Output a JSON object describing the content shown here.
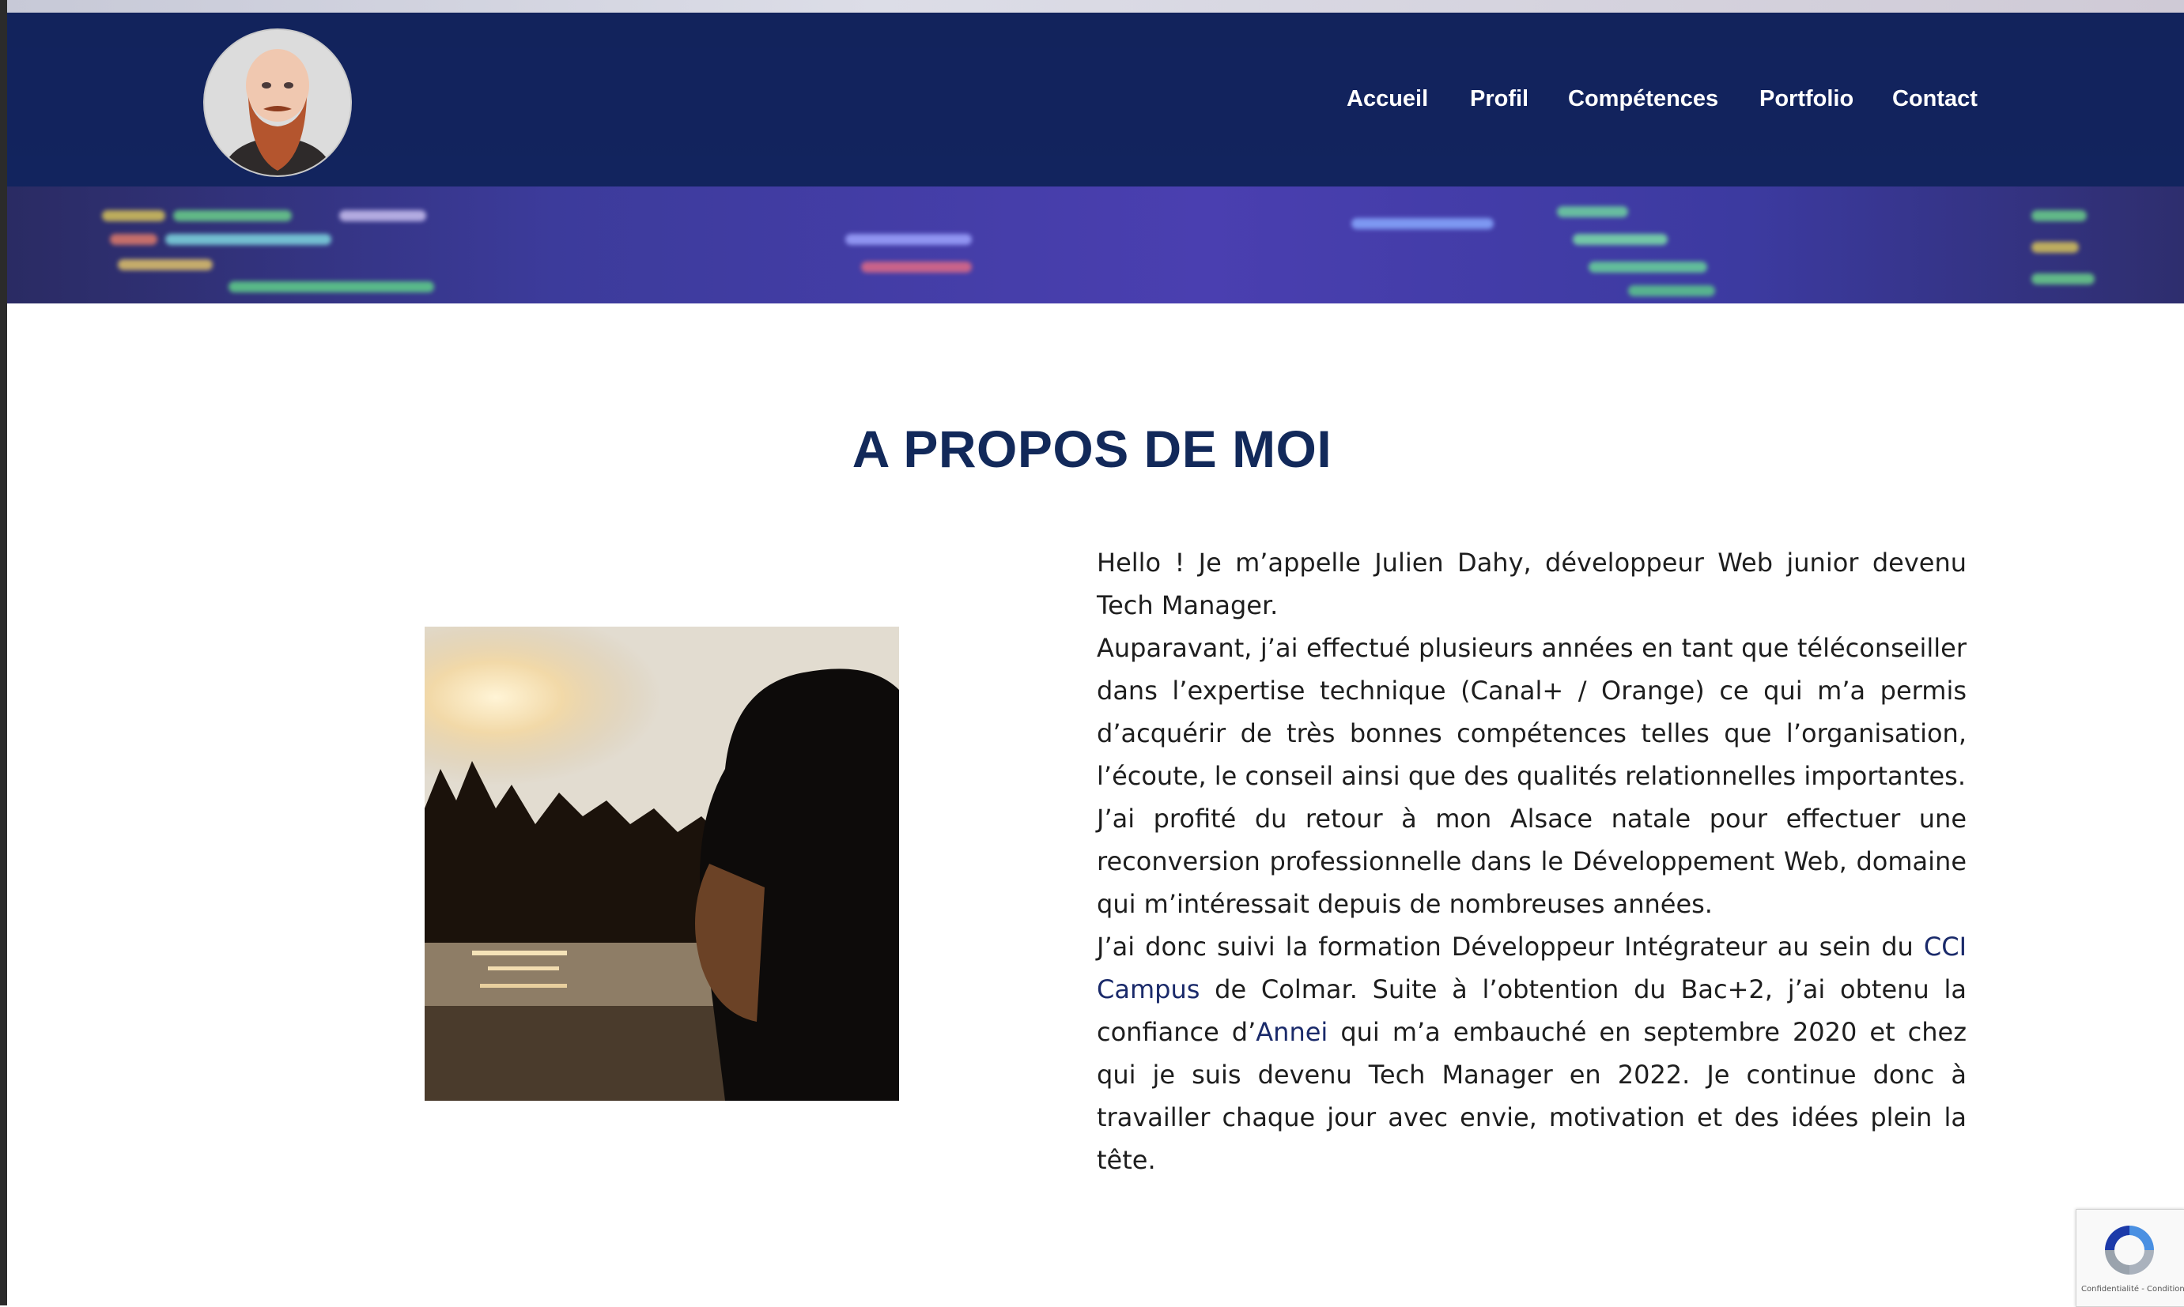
{
  "nav": {
    "items": [
      {
        "label": "Accueil"
      },
      {
        "label": "Profil"
      },
      {
        "label": "Compétences"
      },
      {
        "label": "Portfolio"
      },
      {
        "label": "Contact"
      }
    ]
  },
  "about": {
    "title": "A PROPOS DE MOI",
    "p1": "Hello ! Je m’appelle Julien Dahy, développeur Web junior devenu Tech Manager.",
    "p2": "Auparavant, j’ai effectué plusieurs années en tant que téléconseiller dans l’expertise technique (Canal+ / Orange) ce qui m’a permis d’acquérir de très bonnes compétences telles que l’organisation, l’écoute, le conseil ainsi que des qualités relationnelles importantes.",
    "p3": "J’ai profité du retour à mon Alsace natale pour effectuer une reconversion professionnelle dans le Développement Web, domaine qui m’intéressait depuis de nombreuses années.",
    "p4_a": "J’ai donc suivi la formation Développeur Intégrateur au sein du ",
    "p4_link1": "CCI Campus",
    "p4_b": " de Colmar. Suite à l’obtention du Bac+2, j’ai obtenu la confiance d’",
    "p4_link2": "Annei",
    "p4_c": " qui m’a embauché en septembre 2020 et chez qui je suis devenu Tech Manager en 2022. Je continue donc à travailler chaque jour avec envie, motivation et des idées plein la tête."
  },
  "recaptcha": {
    "footer_text": "Confidentialité - Conditions"
  },
  "colors": {
    "nav_bg": "#12235c",
    "title": "#12295a",
    "link": "#1a2a6a"
  }
}
